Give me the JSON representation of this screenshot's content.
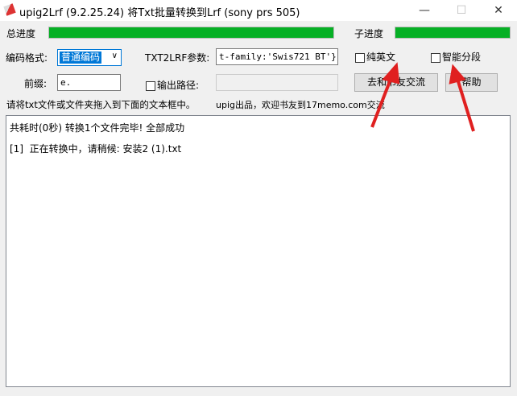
{
  "window": {
    "title": "upig2Lrf (9.2.25.24) 将Txt批量转换到Lrf (sony prs 505)",
    "minimize": "—",
    "maximize": "☐",
    "close": "✕"
  },
  "progress": {
    "total_label": "总进度",
    "total_value": 100,
    "sub_label": "子进度",
    "sub_value": 100
  },
  "encoding": {
    "label": "编码格式:",
    "value": "普通编码"
  },
  "params": {
    "label": "TXT2LRF参数:",
    "value": "t-family:'Swis721 BT'}\""
  },
  "checkboxes": {
    "pure_english": "纯英文",
    "smart_split": "智能分段",
    "output_path": "输出路径:"
  },
  "prefix": {
    "label": "前缀:",
    "value": "e."
  },
  "buttons": {
    "forum": "去和书友交流",
    "help": "帮助"
  },
  "hint": "请将txt文件或文件夹拖入到下面的文本框中。",
  "credit": "upig出品，欢迎书友到17memo.com交流",
  "log": [
    "共耗时(0秒) 转换1个文件完毕! 全部成功",
    "[1]  正在转换中，请稍候: 安装2 (1).txt"
  ],
  "colors": {
    "progress": "#06b025",
    "arrow": "#e02020"
  }
}
